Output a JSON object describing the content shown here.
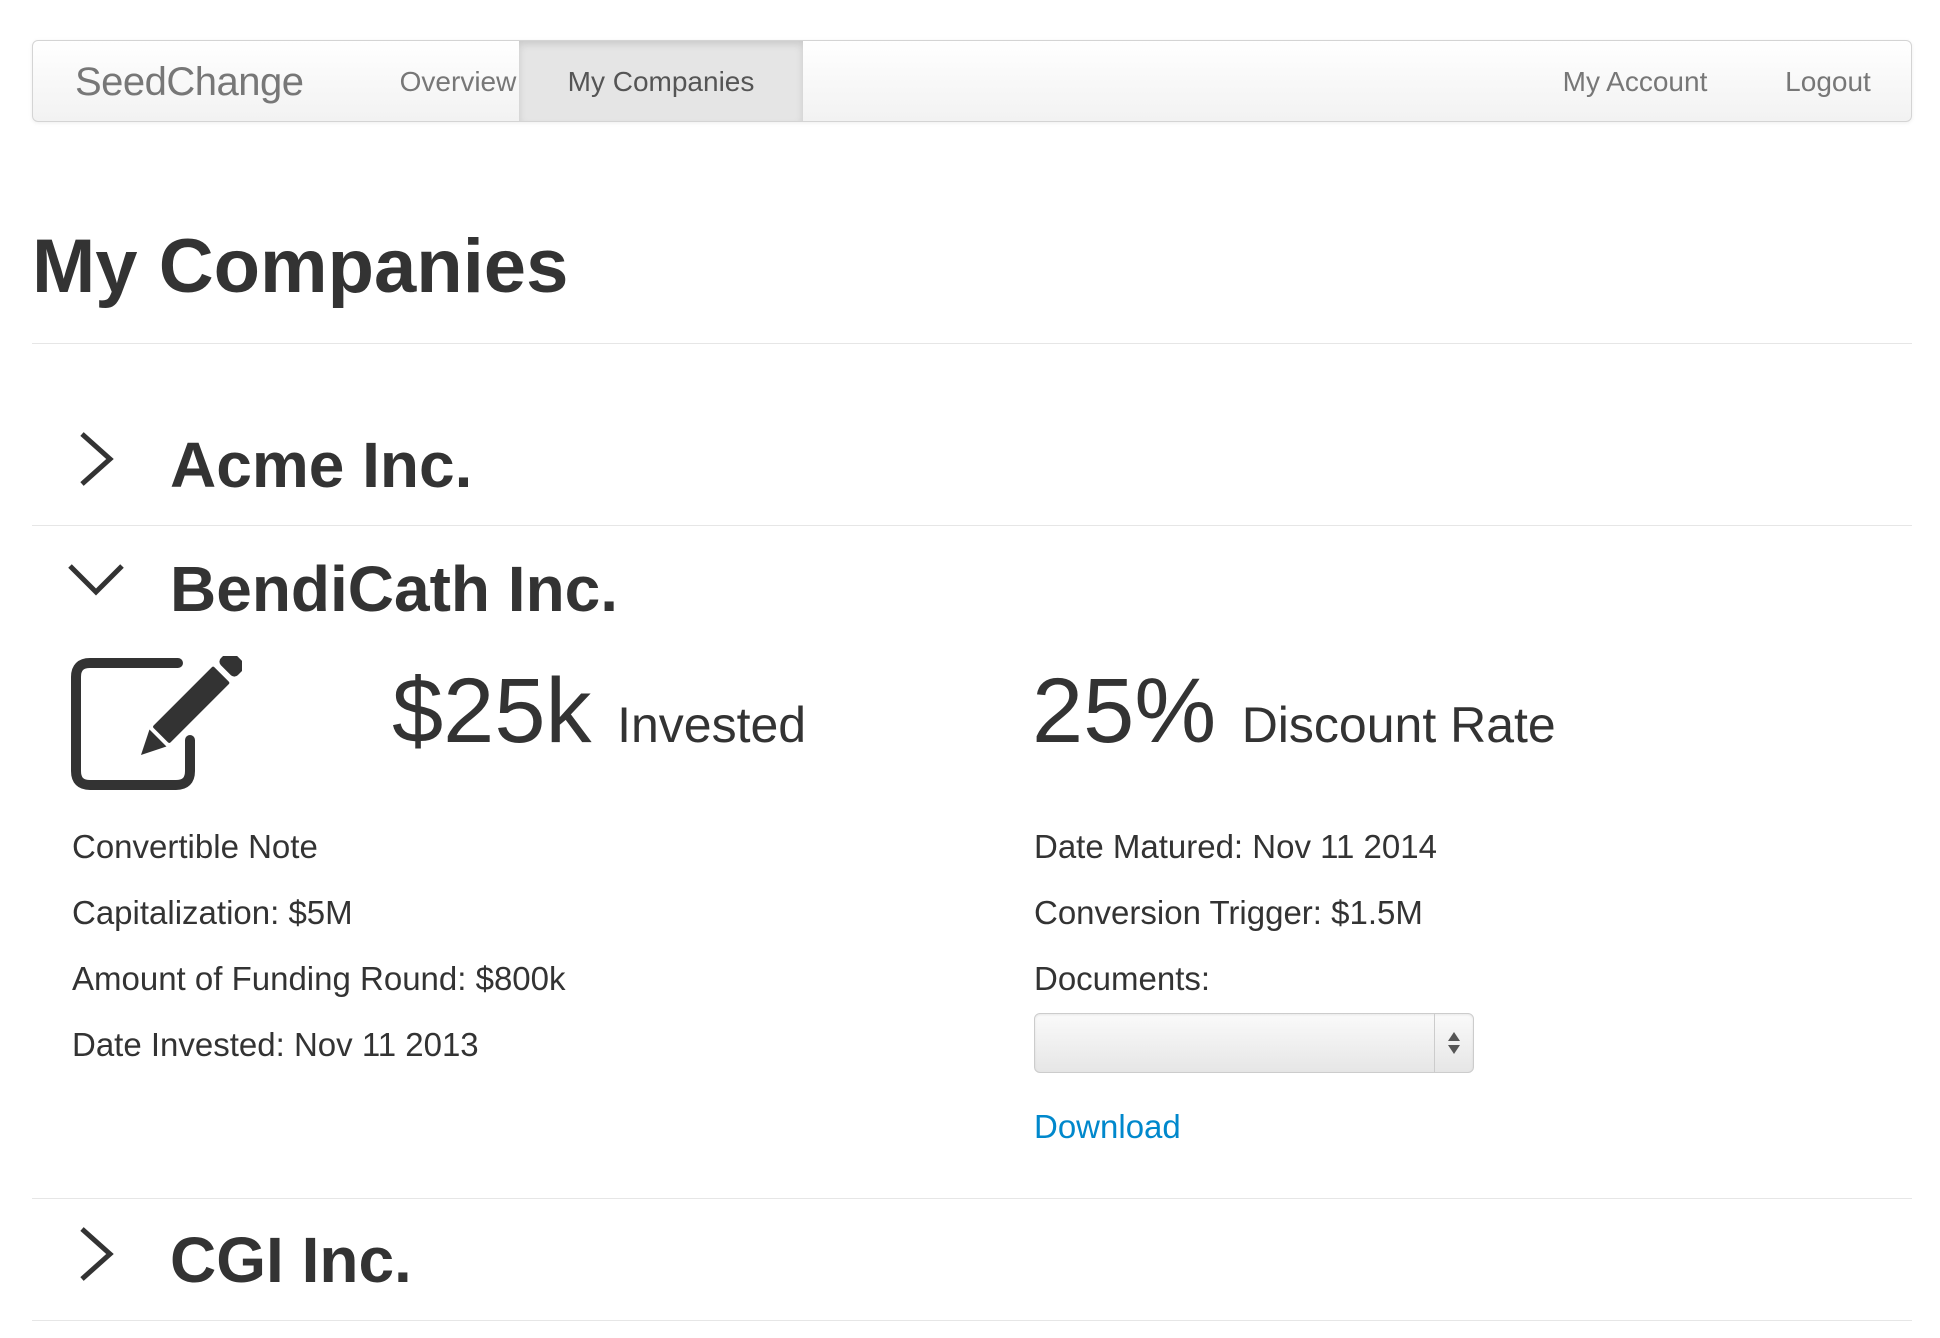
{
  "navbar": {
    "brand": "SeedChange",
    "items": [
      {
        "label": "Overview",
        "active": false
      },
      {
        "label": "My Companies",
        "active": true
      }
    ],
    "right_items": [
      {
        "label": "My Account"
      },
      {
        "label": "Logout"
      }
    ]
  },
  "page": {
    "title": "My Companies"
  },
  "companies": [
    {
      "name": "Acme Inc.",
      "expanded": false,
      "chevron_icon": "chevron-right-icon"
    },
    {
      "name": "BendiCath Inc.",
      "expanded": true,
      "chevron_icon": "chevron-down-icon",
      "edit_icon": "edit-icon",
      "invested_value": "$25k",
      "invested_label": "Invested",
      "discount_value": "25%",
      "discount_label": "Discount Rate",
      "left_details": [
        "Convertible Note",
        "Capitalization: $5M",
        "Amount of Funding Round: $800k",
        "Date Invested: Nov 11 2013"
      ],
      "right_details": [
        "Date Matured: Nov 11 2014",
        "Conversion Trigger: $1.5M",
        "Documents:"
      ],
      "documents_select_value": "",
      "download_label": "Download"
    },
    {
      "name": "CGI Inc.",
      "expanded": false,
      "chevron_icon": "chevron-right-icon"
    }
  ],
  "colors": {
    "text": "#333333",
    "nav_text": "#777777",
    "link": "#0088cc",
    "nav_active_bg": "#e5e5e5",
    "divider": "#e6e6e6"
  }
}
